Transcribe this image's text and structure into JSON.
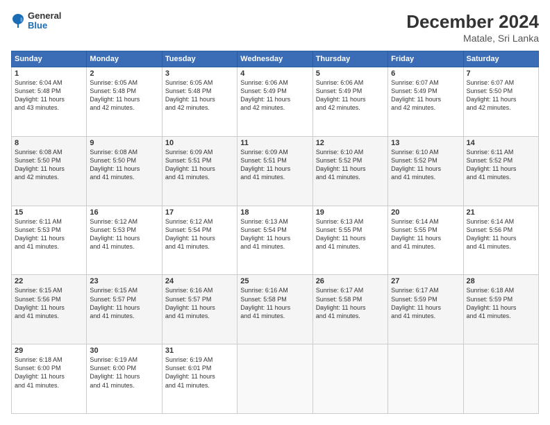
{
  "logo": {
    "general": "General",
    "blue": "Blue"
  },
  "title": "December 2024",
  "subtitle": "Matale, Sri Lanka",
  "calendar": {
    "headers": [
      "Sunday",
      "Monday",
      "Tuesday",
      "Wednesday",
      "Thursday",
      "Friday",
      "Saturday"
    ],
    "weeks": [
      [
        {
          "day": "",
          "info": ""
        },
        {
          "day": "2",
          "info": "Sunrise: 6:05 AM\nSunset: 5:48 PM\nDaylight: 11 hours\nand 42 minutes."
        },
        {
          "day": "3",
          "info": "Sunrise: 6:05 AM\nSunset: 5:48 PM\nDaylight: 11 hours\nand 42 minutes."
        },
        {
          "day": "4",
          "info": "Sunrise: 6:06 AM\nSunset: 5:49 PM\nDaylight: 11 hours\nand 42 minutes."
        },
        {
          "day": "5",
          "info": "Sunrise: 6:06 AM\nSunset: 5:49 PM\nDaylight: 11 hours\nand 42 minutes."
        },
        {
          "day": "6",
          "info": "Sunrise: 6:07 AM\nSunset: 5:49 PM\nDaylight: 11 hours\nand 42 minutes."
        },
        {
          "day": "7",
          "info": "Sunrise: 6:07 AM\nSunset: 5:50 PM\nDaylight: 11 hours\nand 42 minutes."
        }
      ],
      [
        {
          "day": "1",
          "info": "Sunrise: 6:04 AM\nSunset: 5:48 PM\nDaylight: 11 hours\nand 43 minutes."
        },
        {
          "day": "",
          "info": ""
        },
        {
          "day": "",
          "info": ""
        },
        {
          "day": "",
          "info": ""
        },
        {
          "day": "",
          "info": ""
        },
        {
          "day": "",
          "info": ""
        },
        {
          "day": "",
          "info": ""
        }
      ],
      [
        {
          "day": "8",
          "info": "Sunrise: 6:08 AM\nSunset: 5:50 PM\nDaylight: 11 hours\nand 42 minutes."
        },
        {
          "day": "9",
          "info": "Sunrise: 6:08 AM\nSunset: 5:50 PM\nDaylight: 11 hours\nand 41 minutes."
        },
        {
          "day": "10",
          "info": "Sunrise: 6:09 AM\nSunset: 5:51 PM\nDaylight: 11 hours\nand 41 minutes."
        },
        {
          "day": "11",
          "info": "Sunrise: 6:09 AM\nSunset: 5:51 PM\nDaylight: 11 hours\nand 41 minutes."
        },
        {
          "day": "12",
          "info": "Sunrise: 6:10 AM\nSunset: 5:52 PM\nDaylight: 11 hours\nand 41 minutes."
        },
        {
          "day": "13",
          "info": "Sunrise: 6:10 AM\nSunset: 5:52 PM\nDaylight: 11 hours\nand 41 minutes."
        },
        {
          "day": "14",
          "info": "Sunrise: 6:11 AM\nSunset: 5:52 PM\nDaylight: 11 hours\nand 41 minutes."
        }
      ],
      [
        {
          "day": "15",
          "info": "Sunrise: 6:11 AM\nSunset: 5:53 PM\nDaylight: 11 hours\nand 41 minutes."
        },
        {
          "day": "16",
          "info": "Sunrise: 6:12 AM\nSunset: 5:53 PM\nDaylight: 11 hours\nand 41 minutes."
        },
        {
          "day": "17",
          "info": "Sunrise: 6:12 AM\nSunset: 5:54 PM\nDaylight: 11 hours\nand 41 minutes."
        },
        {
          "day": "18",
          "info": "Sunrise: 6:13 AM\nSunset: 5:54 PM\nDaylight: 11 hours\nand 41 minutes."
        },
        {
          "day": "19",
          "info": "Sunrise: 6:13 AM\nSunset: 5:55 PM\nDaylight: 11 hours\nand 41 minutes."
        },
        {
          "day": "20",
          "info": "Sunrise: 6:14 AM\nSunset: 5:55 PM\nDaylight: 11 hours\nand 41 minutes."
        },
        {
          "day": "21",
          "info": "Sunrise: 6:14 AM\nSunset: 5:56 PM\nDaylight: 11 hours\nand 41 minutes."
        }
      ],
      [
        {
          "day": "22",
          "info": "Sunrise: 6:15 AM\nSunset: 5:56 PM\nDaylight: 11 hours\nand 41 minutes."
        },
        {
          "day": "23",
          "info": "Sunrise: 6:15 AM\nSunset: 5:57 PM\nDaylight: 11 hours\nand 41 minutes."
        },
        {
          "day": "24",
          "info": "Sunrise: 6:16 AM\nSunset: 5:57 PM\nDaylight: 11 hours\nand 41 minutes."
        },
        {
          "day": "25",
          "info": "Sunrise: 6:16 AM\nSunset: 5:58 PM\nDaylight: 11 hours\nand 41 minutes."
        },
        {
          "day": "26",
          "info": "Sunrise: 6:17 AM\nSunset: 5:58 PM\nDaylight: 11 hours\nand 41 minutes."
        },
        {
          "day": "27",
          "info": "Sunrise: 6:17 AM\nSunset: 5:59 PM\nDaylight: 11 hours\nand 41 minutes."
        },
        {
          "day": "28",
          "info": "Sunrise: 6:18 AM\nSunset: 5:59 PM\nDaylight: 11 hours\nand 41 minutes."
        }
      ],
      [
        {
          "day": "29",
          "info": "Sunrise: 6:18 AM\nSunset: 6:00 PM\nDaylight: 11 hours\nand 41 minutes."
        },
        {
          "day": "30",
          "info": "Sunrise: 6:19 AM\nSunset: 6:00 PM\nDaylight: 11 hours\nand 41 minutes."
        },
        {
          "day": "31",
          "info": "Sunrise: 6:19 AM\nSunset: 6:01 PM\nDaylight: 11 hours\nand 41 minutes."
        },
        {
          "day": "",
          "info": ""
        },
        {
          "day": "",
          "info": ""
        },
        {
          "day": "",
          "info": ""
        },
        {
          "day": "",
          "info": ""
        }
      ]
    ]
  }
}
